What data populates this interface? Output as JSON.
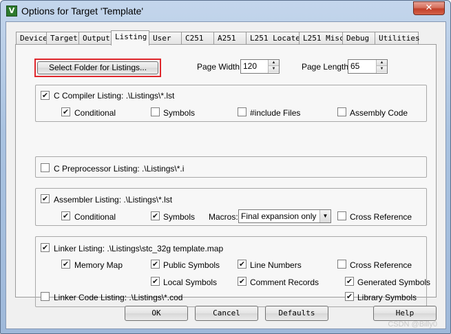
{
  "window": {
    "title": "Options for Target 'Template'",
    "close_label": "✕",
    "app_icon_glyph": "V"
  },
  "tabs": [
    {
      "label": "Device"
    },
    {
      "label": "Target"
    },
    {
      "label": "Output"
    },
    {
      "label": "Listing",
      "active": true
    },
    {
      "label": "User"
    },
    {
      "label": "C251"
    },
    {
      "label": "A251"
    },
    {
      "label": "L251 Locate"
    },
    {
      "label": "L251 Misc"
    },
    {
      "label": "Debug"
    },
    {
      "label": "Utilities"
    }
  ],
  "top": {
    "select_folder_label": "Select Folder for Listings...",
    "page_width_label": "Page Width:",
    "page_width_value": "120",
    "page_length_label": "Page Length:",
    "page_length_value": "65"
  },
  "c_compiler": {
    "label": "C Compiler Listing:  .\\Listings\\*.lst",
    "checked": true,
    "conditional": {
      "label": "Conditional",
      "checked": true
    },
    "symbols": {
      "label": "Symbols",
      "checked": false
    },
    "include_files": {
      "label": "#include Files",
      "checked": false
    },
    "assembly_code": {
      "label": "Assembly Code",
      "checked": false
    }
  },
  "c_preprocessor": {
    "label": "C Preprocessor Listing:  .\\Listings\\*.i",
    "checked": false
  },
  "assembler": {
    "label": "Assembler Listing:  .\\Listings\\*.lst",
    "checked": true,
    "conditional": {
      "label": "Conditional",
      "checked": true
    },
    "symbols": {
      "label": "Symbols",
      "checked": true
    },
    "macros_label": "Macros:",
    "macros_value": "Final expansion only",
    "cross_reference": {
      "label": "Cross Reference",
      "checked": false
    }
  },
  "linker": {
    "label": "Linker Listing:  .\\Listings\\stc_32g template.map",
    "checked": true,
    "memory_map": {
      "label": "Memory Map",
      "checked": true
    },
    "public_symbols": {
      "label": "Public Symbols",
      "checked": true
    },
    "line_numbers": {
      "label": "Line Numbers",
      "checked": true
    },
    "cross_reference": {
      "label": "Cross Reference",
      "checked": false
    },
    "local_symbols": {
      "label": "Local Symbols",
      "checked": true
    },
    "comment_records": {
      "label": "Comment Records",
      "checked": true
    },
    "generated_symbols": {
      "label": "Generated Symbols",
      "checked": true
    },
    "code_listing": {
      "label": "Linker Code Listing:  .\\Listings\\*.cod",
      "checked": false
    },
    "library_symbols": {
      "label": "Library Symbols",
      "checked": true
    }
  },
  "buttons": {
    "ok": "OK",
    "cancel": "Cancel",
    "defaults": "Defaults",
    "help": "Help"
  },
  "check_glyph": "✔",
  "watermark": "CSDN @Billy0",
  "colors": {
    "highlight_border": "#e0262b",
    "titlebar": "#a9c2e0",
    "face": "#f0f0f0"
  }
}
